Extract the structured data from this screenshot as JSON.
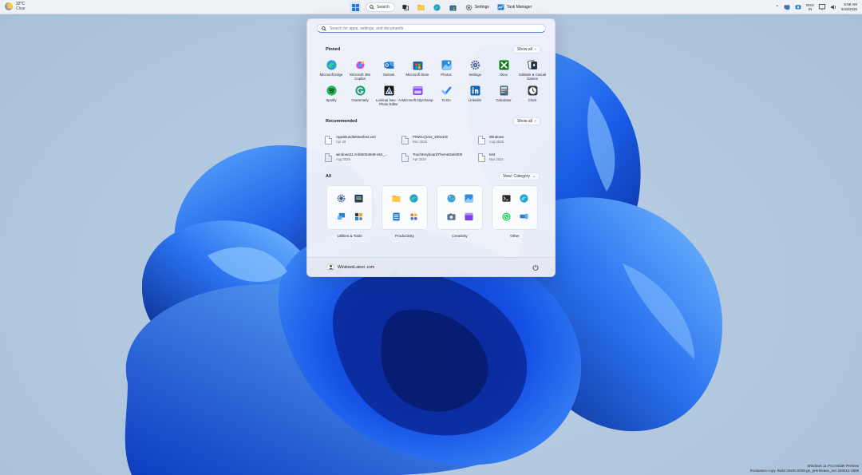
{
  "taskbar": {
    "weather": {
      "temp": "32°C",
      "condition": "Clear"
    },
    "search_label": "Search",
    "apps": [
      {
        "name": "start"
      },
      {
        "name": "search"
      },
      {
        "name": "file-explorer"
      },
      {
        "name": "folder"
      },
      {
        "name": "edge"
      },
      {
        "name": "store"
      }
    ],
    "settings_label": "Settings",
    "task_manager_label": "Task Manager",
    "tray": {
      "lang_line1": "ENG",
      "lang_line2": "IN",
      "time": "5:58 AM",
      "date": "5/18/2026"
    }
  },
  "start_menu": {
    "search_placeholder": "Search for apps, settings, and documents",
    "pinned_title": "Pinned",
    "pinned_show_all": "Show all",
    "pinned": [
      {
        "label": "Microsoft Edge",
        "icon": "edge-icon",
        "color": "#1fa0e0"
      },
      {
        "label": "Microsoft 365 Copilot",
        "icon": "copilot-icon",
        "color": "#c84fd6"
      },
      {
        "label": "Outlook",
        "icon": "outlook-icon",
        "color": "#2b6fd6"
      },
      {
        "label": "Microsoft Store",
        "icon": "store-icon",
        "color": "#1f5fa8"
      },
      {
        "label": "Photos",
        "icon": "photos-icon",
        "color": "#2a8be0"
      },
      {
        "label": "Settings",
        "icon": "settings-icon",
        "color": "#6b7a8c"
      },
      {
        "label": "Xbox",
        "icon": "xbox-icon",
        "color": "#1e7d1e"
      },
      {
        "label": "Solitaire & Casual Games",
        "icon": "solitaire-icon",
        "color": "#2e3a4a"
      },
      {
        "label": "Spotify",
        "icon": "spotify-icon",
        "color": "#1db954"
      },
      {
        "label": "Grammarly",
        "icon": "grammarly-icon",
        "color": "#15a36c"
      },
      {
        "label": "Luminar Neo - AI Photo Editor",
        "icon": "luminar-icon",
        "color": "#1a1a1a"
      },
      {
        "label": "Microsoft Clipchamp",
        "icon": "clipchamp-icon",
        "color": "#7b3fe4"
      },
      {
        "label": "To Do",
        "icon": "todo-icon",
        "color": "#2f7de1"
      },
      {
        "label": "LinkedIn",
        "icon": "linkedin-icon",
        "color": "#0a66c2"
      },
      {
        "label": "Calculator",
        "icon": "calculator-icon",
        "color": "#4b5a6b"
      },
      {
        "label": "Clock",
        "icon": "clock-icon",
        "color": "#3a3a3a"
      }
    ],
    "recommended_title": "Recommended",
    "recommended_show_all": "Show all",
    "recommended": [
      {
        "name": "AppxBundleManifest.xml",
        "date": "Apr 28"
      },
      {
        "name": "PNWLVj1S2_400x400",
        "date": "Dec 2025"
      },
      {
        "name": "Windows",
        "date": "Aug 2025"
      },
      {
        "name": "windows11.0-kb5054848-x64_...",
        "date": "Aug 2025"
      },
      {
        "name": "TouchKeyboardThemeDark000",
        "date": "Apr 2024"
      },
      {
        "name": "test",
        "date": "Mar 2024"
      }
    ],
    "all_title": "All",
    "view_label": "View: Category",
    "categories": [
      {
        "label": "Utilities & Tools",
        "icons": [
          "settings-icon",
          "store-icon",
          "remote-desktop-icon",
          "control-panel-icon"
        ]
      },
      {
        "label": "Productivity",
        "icons": [
          "folder-icon",
          "edge-icon",
          "notepad-icon",
          "people-icon"
        ]
      },
      {
        "label": "Creativity",
        "icons": [
          "paint-icon",
          "photos-icon",
          "camera-icon",
          "clipchamp-icon"
        ]
      },
      {
        "label": "Other",
        "icons": [
          "terminal-icon",
          "edge-beta-icon",
          "whatsapp-icon",
          "phone-link-icon"
        ]
      }
    ],
    "user_name": "WindowsLatest .com"
  },
  "watermark": {
    "line1": "Windows 11 Pro Insider Preview",
    "line2": "Evaluation copy. Build 26200.6000.ge_prerelease_svc.260512-1809"
  }
}
